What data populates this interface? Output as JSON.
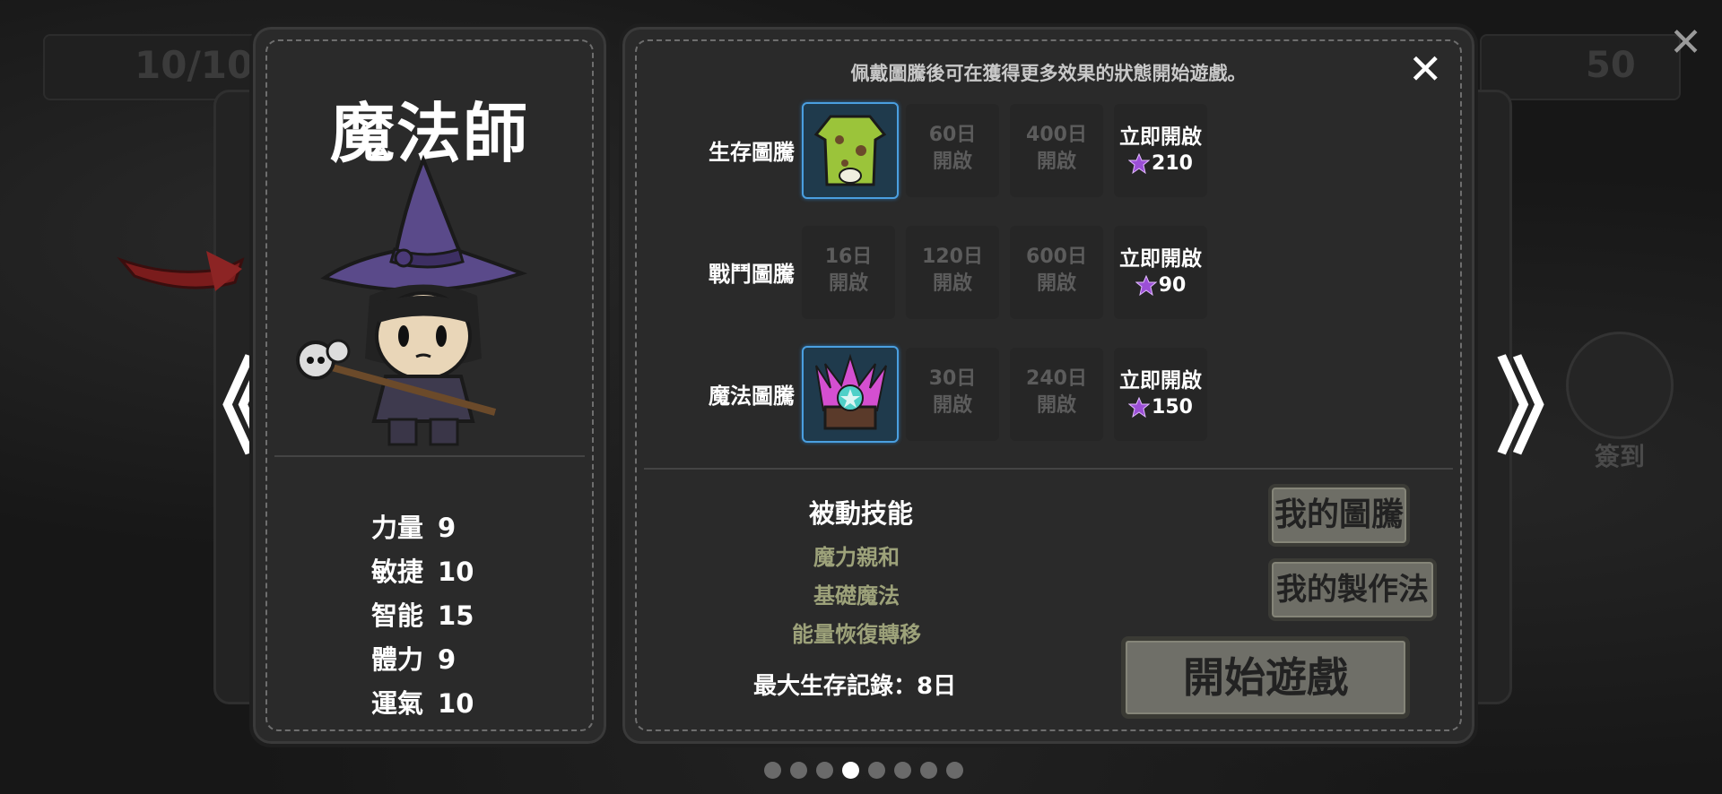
{
  "background": {
    "top_left_counter": "10/10",
    "top_right_gems": "50",
    "checkin_label": "簽到"
  },
  "character": {
    "class_name": "魔法師",
    "stats": [
      {
        "label": "力量",
        "value": "9"
      },
      {
        "label": "敏捷",
        "value": "10"
      },
      {
        "label": "智能",
        "value": "15"
      },
      {
        "label": "體力",
        "value": "9"
      },
      {
        "label": "運氣",
        "value": "10"
      }
    ]
  },
  "totem_panel": {
    "hint": "佩戴圖騰後可在獲得更多效果的狀態開始遊戲。",
    "close_symbol": "✕",
    "rows": [
      {
        "label": "生存圖騰",
        "owned_icon": "green-robe-totem-icon",
        "slots": [
          {
            "day": "60日",
            "text": "開啟"
          },
          {
            "day": "400日",
            "text": "開啟"
          }
        ],
        "unlock": {
          "text": "立即開啟",
          "cost": "210"
        }
      },
      {
        "label": "戰鬥圖騰",
        "owned_icon": null,
        "slots": [
          {
            "day": "16日",
            "text": "開啟"
          },
          {
            "day": "120日",
            "text": "開啟"
          },
          {
            "day": "600日",
            "text": "開啟"
          }
        ],
        "unlock": {
          "text": "立即開啟",
          "cost": "90"
        }
      },
      {
        "label": "魔法圖騰",
        "owned_icon": "magic-crystal-totem-icon",
        "slots": [
          {
            "day": "30日",
            "text": "開啟"
          },
          {
            "day": "240日",
            "text": "開啟"
          }
        ],
        "unlock": {
          "text": "立即開啟",
          "cost": "150"
        }
      }
    ],
    "passive_title": "被動技能",
    "passive_skills": [
      "魔力親和",
      "基礎魔法",
      "能量恢復轉移"
    ],
    "max_record": "最大生存記錄：8日",
    "buttons": {
      "my_totem": "我的圖騰",
      "my_recipe": "我的製作法",
      "start_game": "開始遊戲"
    }
  },
  "navigation": {
    "prev": "《",
    "next": "》",
    "page_count": 8,
    "active_page": 4
  },
  "colors": {
    "gem_purple": "#9b4fd6",
    "owned_border": "#4a9fe0",
    "skill_text": "#9da27a"
  }
}
